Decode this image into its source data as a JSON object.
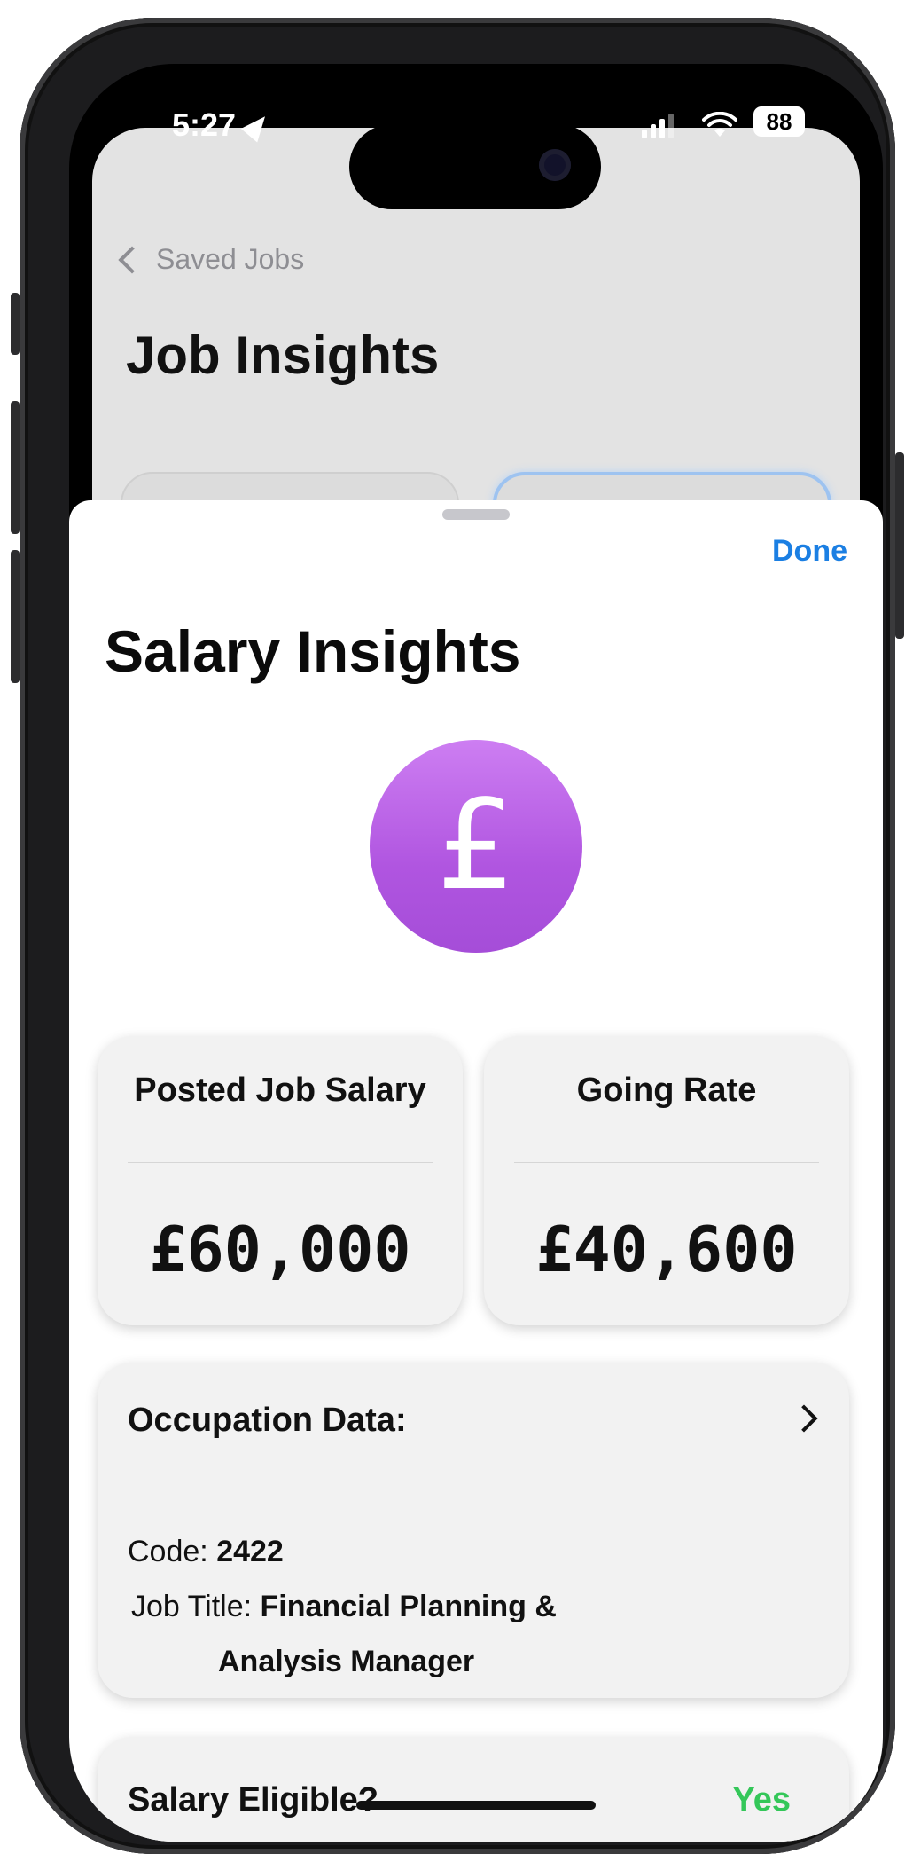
{
  "status_bar": {
    "time": "5:27",
    "battery": "88"
  },
  "background_screen": {
    "back_label": "Saved Jobs",
    "title": "Job Insights"
  },
  "sheet": {
    "done_label": "Done",
    "title": "Salary Insights",
    "currency_symbol": "£",
    "currency_color": "#b866e6",
    "posted_salary": {
      "label": "Posted Job Salary",
      "value": "£60,000"
    },
    "going_rate": {
      "label": "Going Rate",
      "value": "£40,600"
    },
    "occupation": {
      "title": "Occupation Data:",
      "code_label": "Code:",
      "code_value": "2422",
      "job_title_label": "Job Title:",
      "job_title_line1": "Financial Planning &",
      "job_title_line2": "Analysis Manager"
    },
    "eligibility": {
      "label": "Salary Eligible?",
      "value": "Yes",
      "value_color": "#34c759"
    }
  },
  "colors": {
    "accent": "#1b7fe3"
  }
}
